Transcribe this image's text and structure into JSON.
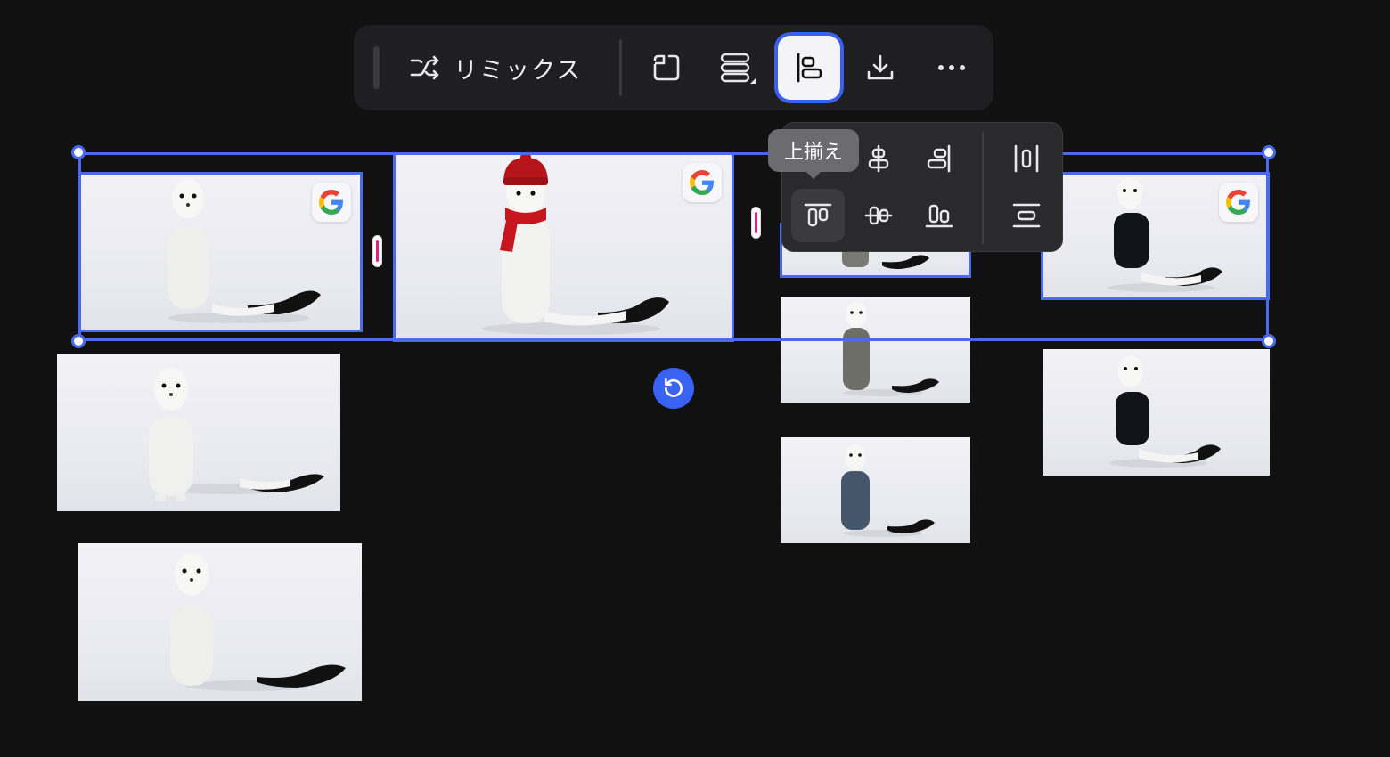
{
  "toolbar": {
    "remix_label": "リミックス",
    "icons": [
      "remix-icon",
      "frame-icon",
      "layout-icon",
      "align-icon",
      "download-icon",
      "more-icon"
    ]
  },
  "align_popover": {
    "tooltip": "上揃え",
    "icons": [
      "align-left-icon",
      "align-center-horizontal-icon",
      "align-right-icon",
      "distribute-horizontal-icon",
      "align-top-icon",
      "align-middle-vertical-icon",
      "align-bottom-icon",
      "distribute-vertical-icon"
    ]
  },
  "canvas": {
    "tiles": [
      {
        "outfit": "white-sweater",
        "selected": true,
        "badge": true
      },
      {
        "outfit": "red-hat-scarf",
        "selected": true,
        "badge": true
      },
      {
        "outfit": "gray-outfit",
        "selected": true,
        "badge": false
      },
      {
        "outfit": "black-sweater",
        "selected": true,
        "badge": true
      },
      {
        "outfit": "white-knit",
        "selected": false,
        "badge": false
      },
      {
        "outfit": "white-turtleneck",
        "selected": false,
        "badge": false
      },
      {
        "outfit": "gray-hoodie",
        "selected": false,
        "badge": false
      },
      {
        "outfit": "denim-overalls",
        "selected": false,
        "badge": false
      },
      {
        "outfit": "black-sweater",
        "selected": false,
        "badge": false
      }
    ]
  },
  "colors": {
    "accent": "#4a6bf0",
    "background": "#111112",
    "gap_marker": "#e0218a",
    "rotate": "#3b63f3"
  }
}
